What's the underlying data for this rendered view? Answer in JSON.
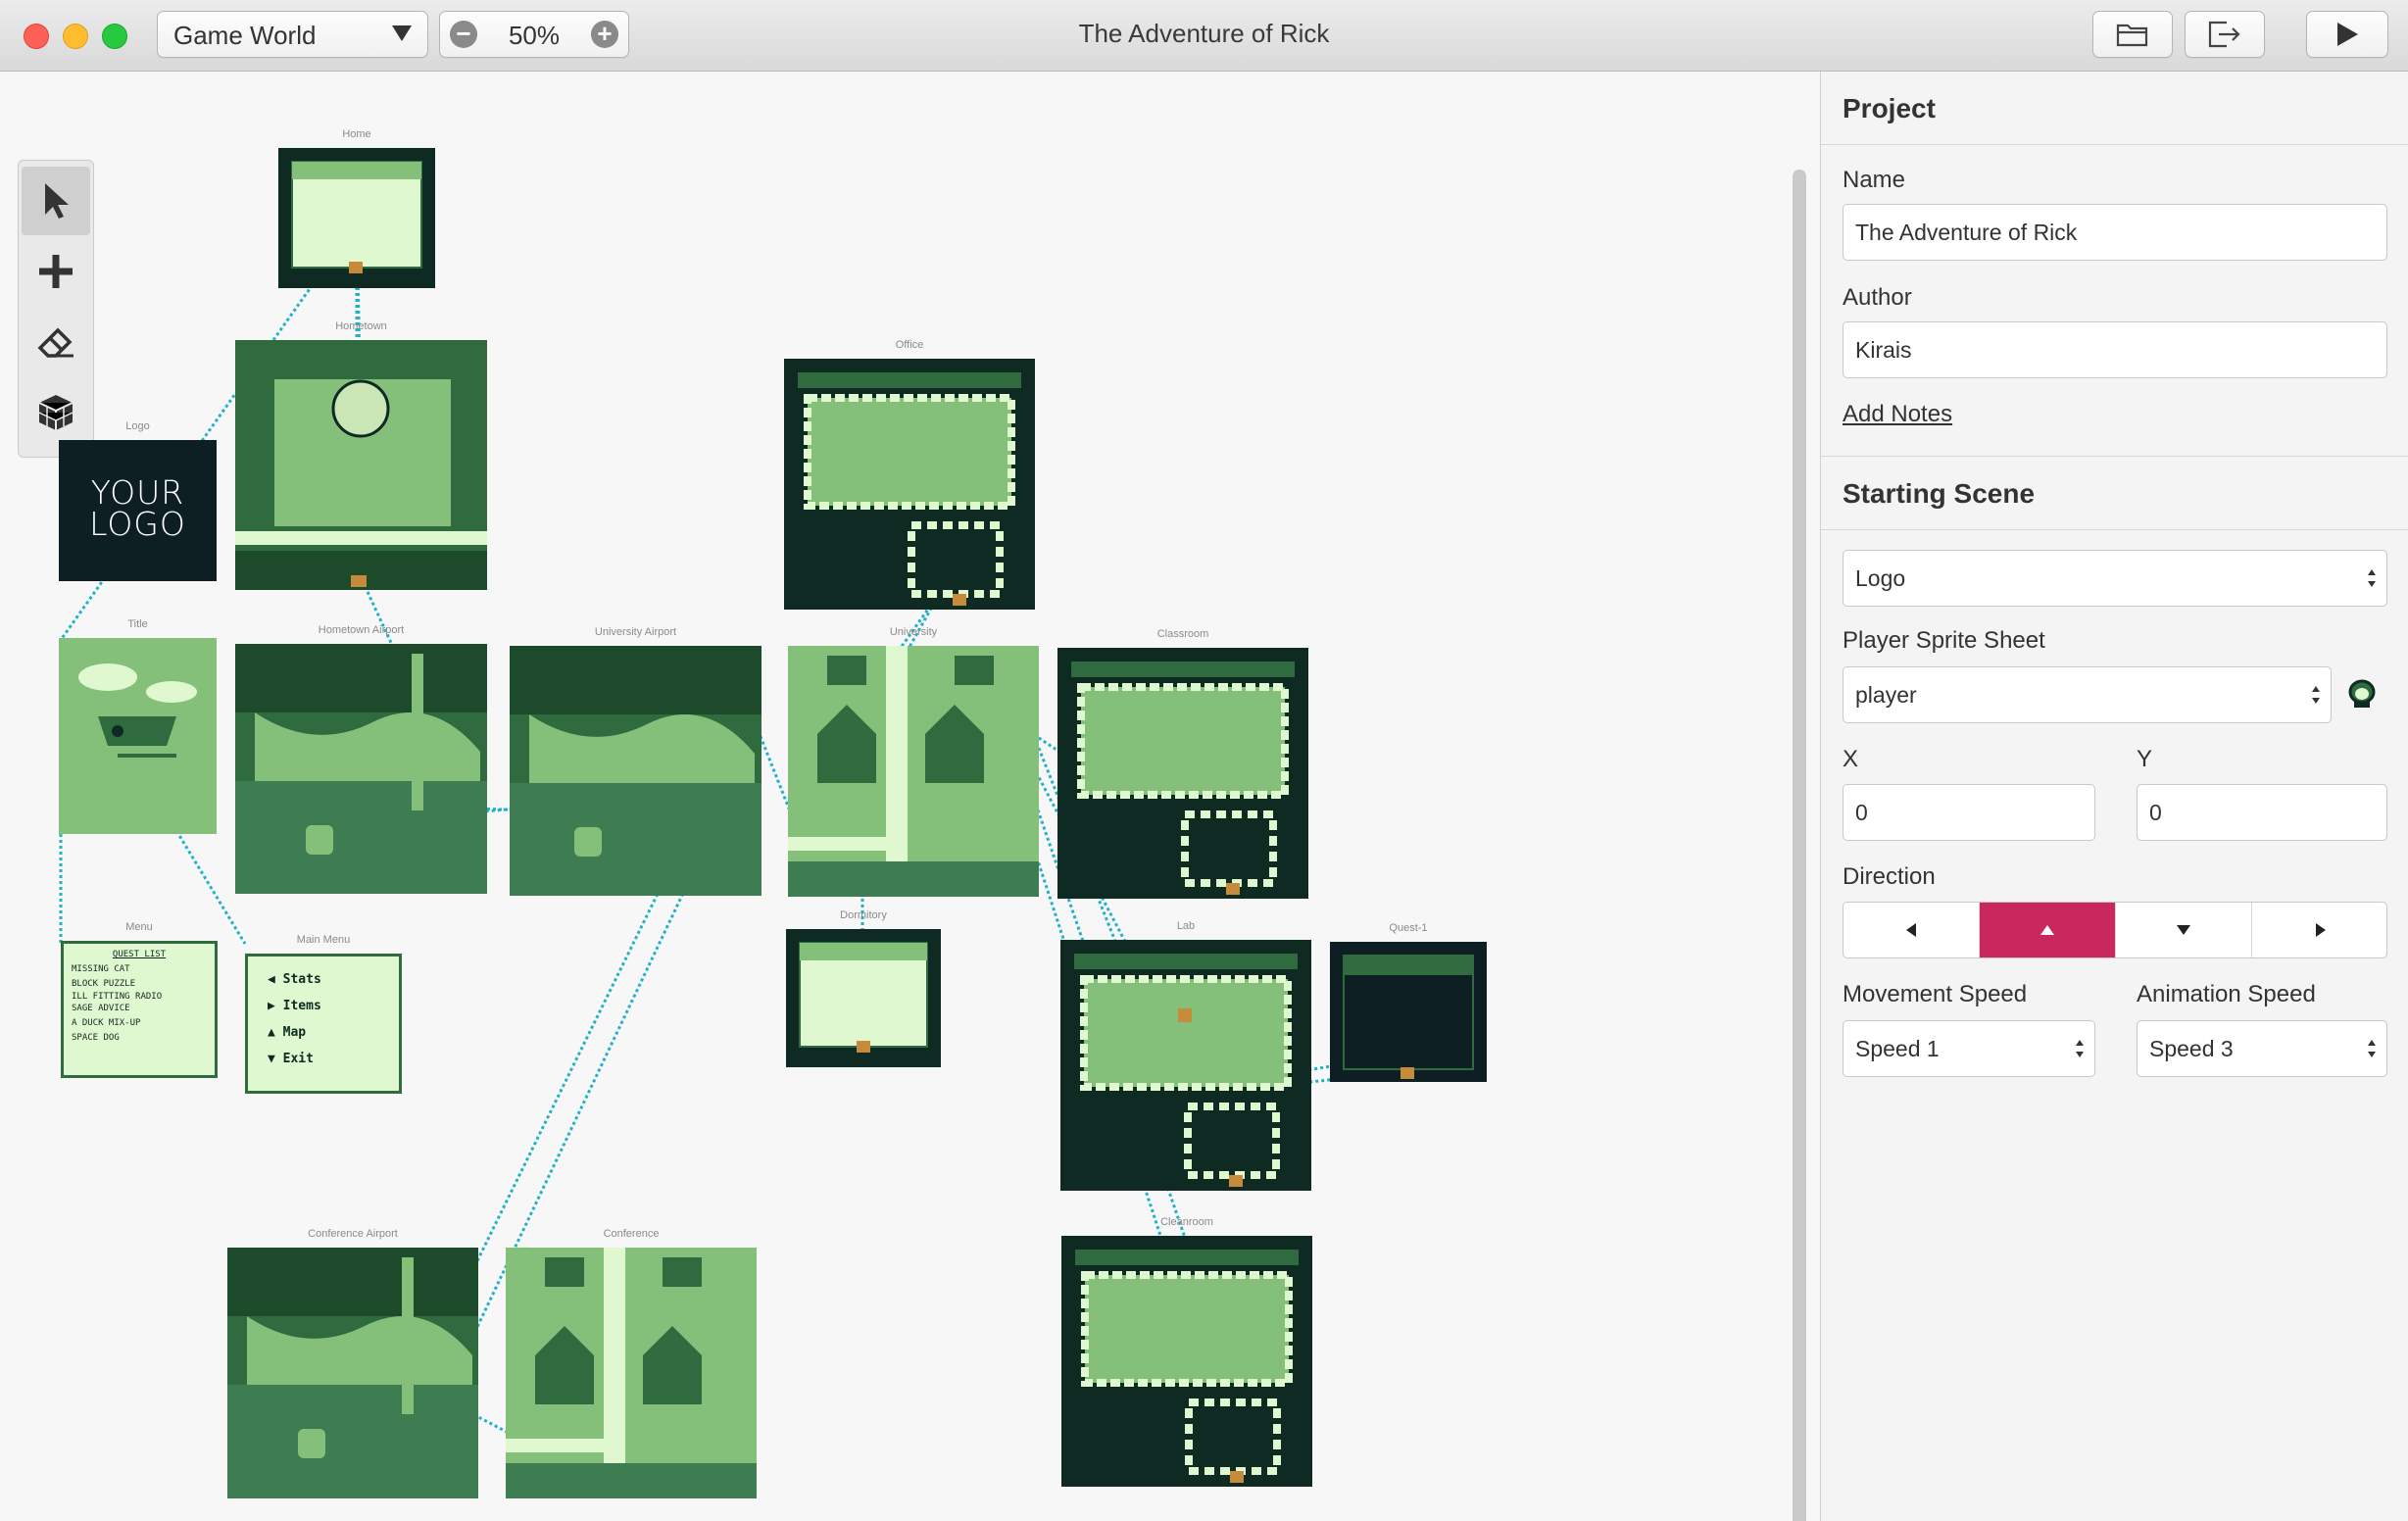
{
  "window": {
    "title": "The Adventure of Rick",
    "world_select": "Game World",
    "zoom": "50%"
  },
  "toolbar": {
    "buttons": [
      "folder-open-icon",
      "export-icon",
      "play-icon"
    ],
    "tools": [
      "select-tool",
      "add-tool",
      "eraser-tool",
      "3d-cube-tool"
    ]
  },
  "scenes": [
    {
      "name": "Home"
    },
    {
      "name": "Hometown"
    },
    {
      "name": "Logo",
      "logo_text": "YOUR LOGO"
    },
    {
      "name": "Title"
    },
    {
      "name": "Menu",
      "lines": [
        "QUEST LIST",
        "MISSING CAT",
        "BLOCK PUZZLE",
        "ILL FITTING RADIO",
        "SAGE ADVICE",
        "A DUCK MIX-UP",
        "SPACE DOG"
      ]
    },
    {
      "name": "Main Menu",
      "items": [
        "Stats",
        "Items",
        "Map",
        "Exit"
      ]
    },
    {
      "name": "Hometown Airport"
    },
    {
      "name": "University Airport"
    },
    {
      "name": "Office"
    },
    {
      "name": "University"
    },
    {
      "name": "Classroom"
    },
    {
      "name": "Dormitory"
    },
    {
      "name": "Lab"
    },
    {
      "name": "Quest-1"
    },
    {
      "name": "Conference Airport"
    },
    {
      "name": "Conference"
    },
    {
      "name": "Cleanroom"
    }
  ],
  "sidebar": {
    "project": {
      "heading": "Project",
      "name_label": "Name",
      "name_value": "The Adventure of Rick",
      "author_label": "Author",
      "author_value": "Kirais",
      "add_notes": "Add Notes"
    },
    "starting_scene": {
      "heading": "Starting Scene",
      "scene_value": "Logo",
      "sprite_label": "Player Sprite Sheet",
      "sprite_value": "player",
      "x_label": "X",
      "x_value": "0",
      "y_label": "Y",
      "y_value": "0",
      "direction_label": "Direction",
      "directions": [
        "left",
        "up",
        "down",
        "right"
      ],
      "direction_selected": "up",
      "movement_speed_label": "Movement Speed",
      "movement_speed_value": "Speed 1",
      "animation_speed_label": "Animation Speed",
      "animation_speed_value": "Speed 3"
    }
  },
  "colors": {
    "accent": "#c9285f",
    "connection": "#1eb2c8",
    "gb_dark": "#0e2a22",
    "gb_mid": "#2f6b3e",
    "gb_light": "#84c07a",
    "gb_pale": "#e0f8cf"
  }
}
